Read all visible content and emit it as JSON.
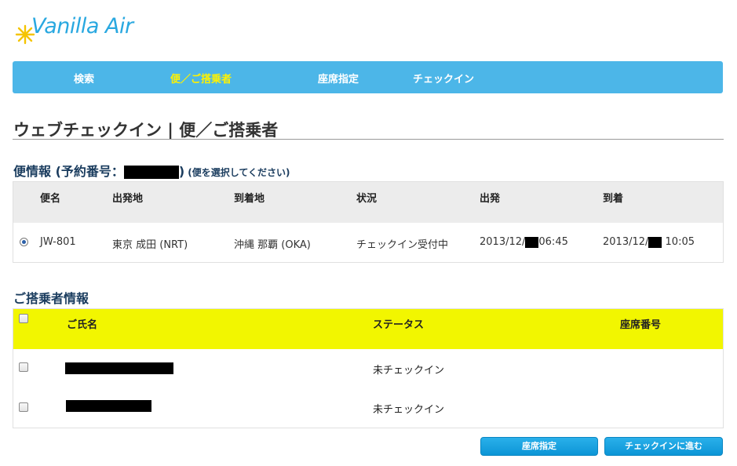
{
  "logo": {
    "text": "Vanilla Air"
  },
  "nav": {
    "tabs": [
      {
        "label": "検索",
        "active": false
      },
      {
        "label": "便／ご搭乗者",
        "active": true
      },
      {
        "label": "座席指定",
        "active": false
      },
      {
        "label": "チェックイン",
        "active": false
      }
    ]
  },
  "page_title": "ウェブチェックイン | 便／ご搭乗者",
  "flight_section": {
    "title_prefix": "便情報 (予約番号：",
    "title_suffix": ")",
    "note": "(便を選択してください)",
    "columns": [
      "便名",
      "出発地",
      "到着地",
      "状況",
      "出発",
      "到着"
    ],
    "row": {
      "selected": true,
      "flight": "JW-801",
      "origin": "東京 成田 (NRT)",
      "destination": "沖縄 那覇 (OKA)",
      "status": "チェックイン受付中",
      "departure_date": "2013/12/",
      "departure_time": "06:45",
      "arrival_date": "2013/12/",
      "arrival_time": "10:05"
    }
  },
  "passenger_section": {
    "title": "ご搭乗者情報",
    "columns": [
      "ご氏名",
      "ステータス",
      "座席番号"
    ],
    "rows": [
      {
        "status": "未チェックイン",
        "seat": ""
      },
      {
        "status": "未チェックイン",
        "seat": ""
      }
    ]
  },
  "buttons": {
    "seat_select": "座席指定",
    "proceed_checkin": "チェックインに進む"
  },
  "colors": {
    "nav_bg": "#4cb6e8",
    "nav_active": "#fff200",
    "passenger_header_bg": "#f2f600",
    "button_bg": "#0c95d6",
    "logo_blue": "#29a8e0"
  }
}
